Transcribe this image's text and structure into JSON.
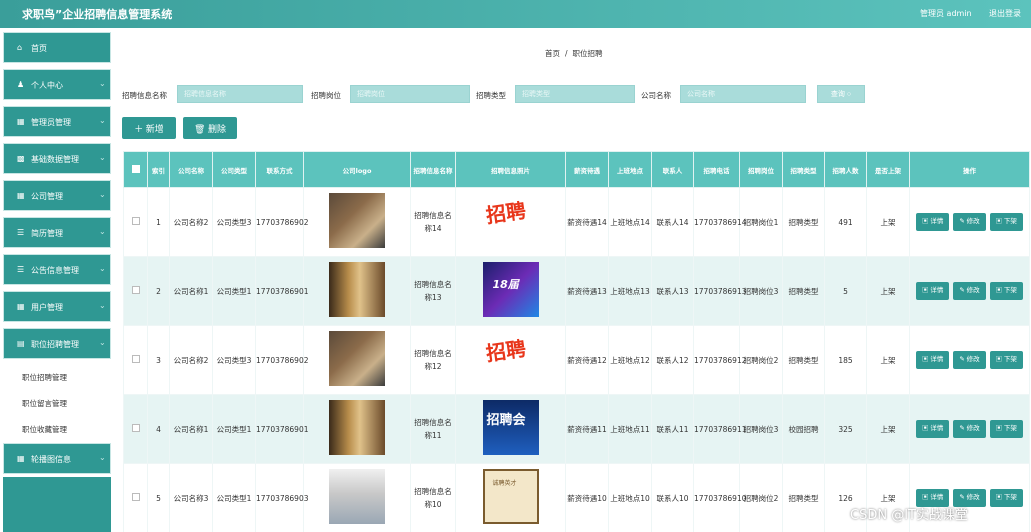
{
  "header": {
    "title": "求职鸟”企业招聘信息管理系统",
    "user": "管理员 admin",
    "logout": "退出登录"
  },
  "sidebar": {
    "items": [
      {
        "label": "首页",
        "icon": "home-icon",
        "glyph": "⌂",
        "chevron": false
      },
      {
        "label": "个人中心",
        "icon": "user-icon",
        "glyph": "♟",
        "chevron": true
      },
      {
        "label": "管理员管理",
        "icon": "grid-icon",
        "glyph": "▦",
        "chevron": true
      },
      {
        "label": "基础数据管理",
        "icon": "data-icon",
        "glyph": "▩",
        "chevron": true
      },
      {
        "label": "公司管理",
        "icon": "grid-icon",
        "glyph": "▦",
        "chevron": true
      },
      {
        "label": "简历管理",
        "icon": "list-icon",
        "glyph": "☰",
        "chevron": true
      },
      {
        "label": "公告信息管理",
        "icon": "list-icon",
        "glyph": "☰",
        "chevron": true
      },
      {
        "label": "用户管理",
        "icon": "grid-icon",
        "glyph": "▦",
        "chevron": true
      },
      {
        "label": "职位招聘管理",
        "icon": "doc-icon",
        "glyph": "▤",
        "chevron": true
      },
      {
        "label": "轮播图信息",
        "icon": "grid-icon",
        "glyph": "▦",
        "chevron": true
      }
    ],
    "sub_items": [
      "职位招聘管理",
      "职位留言管理",
      "职位收藏管理"
    ]
  },
  "breadcrumb": {
    "home": "首页",
    "sep": "/",
    "current": "职位招聘"
  },
  "search": {
    "fields": [
      {
        "label": "招聘信息名称",
        "placeholder": "招聘信息名称"
      },
      {
        "label": "招聘岗位",
        "placeholder": "招聘岗位"
      },
      {
        "label": "招聘类型",
        "placeholder": "招聘类型"
      },
      {
        "label": "公司名称",
        "placeholder": "公司名称"
      }
    ],
    "button": "查询 ○"
  },
  "actions": {
    "add": "＋ 新增",
    "delete": "🗑 删除"
  },
  "table": {
    "columns": [
      "",
      "索引",
      "公司名称",
      "公司类型",
      "联系方式",
      "公司logo",
      "招聘信息名称",
      "招聘信息照片",
      "薪资待遇",
      "上班地点",
      "联系人",
      "招聘电话",
      "招聘岗位",
      "招聘类型",
      "招聘人数",
      "是否上架",
      "操作"
    ],
    "rows": [
      {
        "index": "1",
        "company": "公司名称2",
        "ctype": "公司类型3",
        "contact": "17703786902",
        "logo": "v1",
        "name": "招聘信息名称14",
        "poster": "p1",
        "poster_text": "招聘",
        "salary": "薪资待遇14",
        "place": "上班地点14",
        "person": "联系人14",
        "phone": "17703786914",
        "post": "招聘岗位1",
        "rtype": "招聘类型",
        "count": "491",
        "status": "上架"
      },
      {
        "index": "2",
        "company": "公司名称1",
        "ctype": "公司类型1",
        "contact": "17703786901",
        "logo": "v2",
        "name": "招聘信息名称13",
        "poster": "p2",
        "poster_text": "18届",
        "salary": "薪资待遇13",
        "place": "上班地点13",
        "person": "联系人13",
        "phone": "17703786913",
        "post": "招聘岗位3",
        "rtype": "招聘类型",
        "count": "5",
        "status": "上架"
      },
      {
        "index": "3",
        "company": "公司名称2",
        "ctype": "公司类型3",
        "contact": "17703786902",
        "logo": "v1",
        "name": "招聘信息名称12",
        "poster": "p1",
        "poster_text": "招聘",
        "salary": "薪资待遇12",
        "place": "上班地点12",
        "person": "联系人12",
        "phone": "17703786912",
        "post": "招聘岗位2",
        "rtype": "招聘类型",
        "count": "185",
        "status": "上架"
      },
      {
        "index": "4",
        "company": "公司名称1",
        "ctype": "公司类型1",
        "contact": "17703786901",
        "logo": "v2",
        "name": "招聘信息名称11",
        "poster": "p3",
        "poster_text": "招聘会",
        "salary": "薪资待遇11",
        "place": "上班地点11",
        "person": "联系人11",
        "phone": "17703786911",
        "post": "招聘岗位3",
        "rtype": "校园招聘",
        "count": "325",
        "status": "上架"
      },
      {
        "index": "5",
        "company": "公司名称3",
        "ctype": "公司类型1",
        "contact": "17703786903",
        "logo": "v3",
        "name": "招聘信息名称10",
        "poster": "p4",
        "poster_text": "诚聘英才",
        "salary": "薪资待遇10",
        "place": "上班地点10",
        "person": "联系人10",
        "phone": "17703786910",
        "post": "招聘岗位2",
        "rtype": "招聘类型",
        "count": "126",
        "status": "上架"
      }
    ],
    "ops": {
      "detail": "▣ 详情",
      "edit": "✎ 修改",
      "off": "▣ 下架"
    }
  },
  "watermark": "CSDN @IT实战课堂"
}
